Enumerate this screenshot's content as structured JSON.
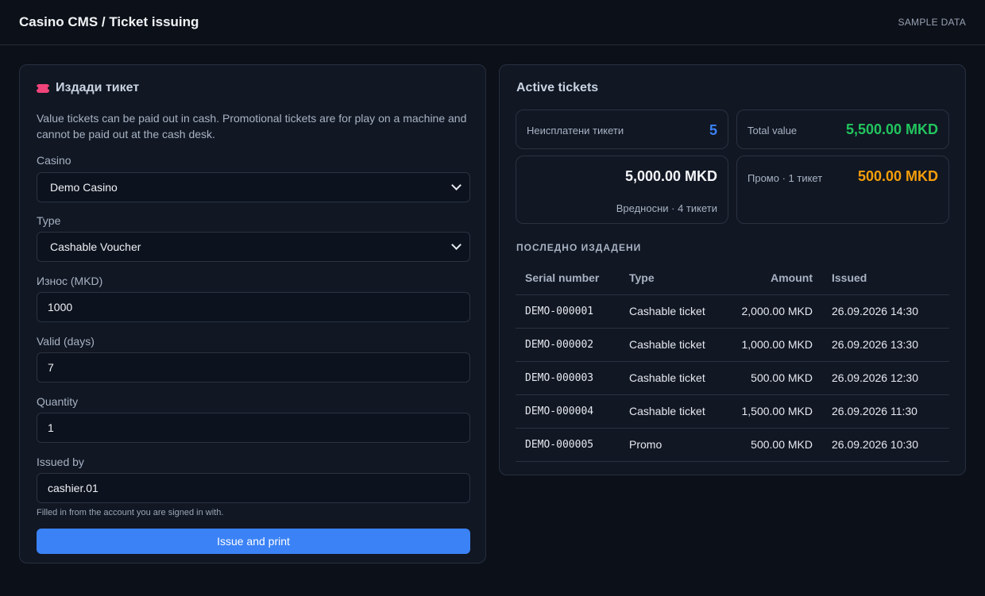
{
  "header": {
    "title": "Casino CMS / Ticket issuing",
    "badge": "SAMPLE DATA"
  },
  "issue_form": {
    "title": "Издади тикет",
    "icon": "ticket-icon",
    "description": "Value tickets can be paid out in cash. Promotional tickets are for play on a machine and cannot be paid out at the cash desk.",
    "casino": {
      "label": "Casino",
      "value": "Demo Casino"
    },
    "type": {
      "label": "Type",
      "value": "Cashable Voucher"
    },
    "amount": {
      "label": "Износ (MKD)",
      "value": "1000"
    },
    "valid_days": {
      "label": "Valid (days)",
      "value": "7"
    },
    "quantity": {
      "label": "Quantity",
      "value": "1"
    },
    "issued_by": {
      "label": "Issued by",
      "value": "cashier.01",
      "hint": "Filled in from the account you are signed in with."
    },
    "submit_label": "Issue and print"
  },
  "active": {
    "title": "Active tickets",
    "unpaid": {
      "label": "Неисплатени тикети",
      "value": "5"
    },
    "total": {
      "label": "Total value",
      "value": "5,500.00 MKD"
    },
    "cashable": {
      "value": "5,000.00 MKD",
      "label": "Вредносни · 4 тикети"
    },
    "promo": {
      "label": "Промо · 1 тикет",
      "value": "500.00 MKD"
    },
    "recent_title": "ПОСЛЕДНО ИЗДАДЕНИ",
    "columns": [
      "Serial number",
      "Type",
      "Amount",
      "Issued"
    ],
    "rows": [
      {
        "serial": "DEMO-000001",
        "type": "Cashable ticket",
        "amount": "2,000.00 MKD",
        "issued": "26.09.2026 14:30"
      },
      {
        "serial": "DEMO-000002",
        "type": "Cashable ticket",
        "amount": "1,000.00 MKD",
        "issued": "26.09.2026 13:30"
      },
      {
        "serial": "DEMO-000003",
        "type": "Cashable ticket",
        "amount": "500.00 MKD",
        "issued": "26.09.2026 12:30"
      },
      {
        "serial": "DEMO-000004",
        "type": "Cashable ticket",
        "amount": "1,500.00 MKD",
        "issued": "26.09.2026 11:30"
      },
      {
        "serial": "DEMO-000005",
        "type": "Promo",
        "amount": "500.00 MKD",
        "issued": "26.09.2026 10:30"
      }
    ]
  },
  "colors": {
    "accent": "#3b82f6",
    "positive": "#22c55e",
    "promo": "#f59e0b",
    "ticket_icon": "#f0447a"
  }
}
